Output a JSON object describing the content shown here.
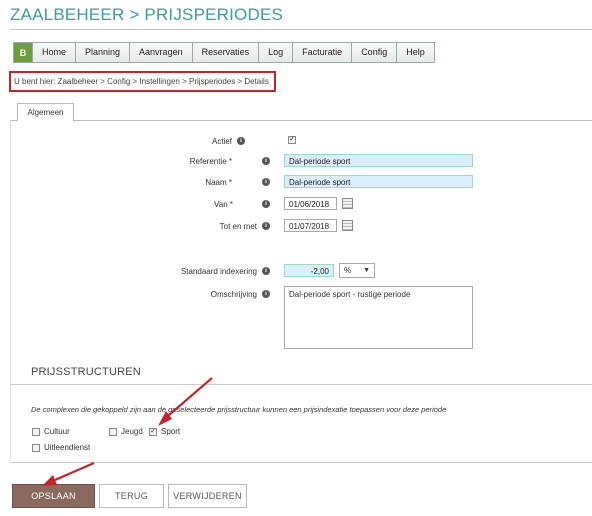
{
  "header": {
    "title": "ZAALBEHEER > PRIJSPERIODES"
  },
  "nav": {
    "logo": "B",
    "items": [
      "Home",
      "Planning",
      "Aanvragen",
      "Reservaties",
      "Log",
      "Facturatie",
      "Config",
      "Help"
    ]
  },
  "breadcrumb": "U bent hier: Zaalbeheer > Config > Instellingen > Prijsperiodes > Details",
  "tabs": [
    "Algemeen"
  ],
  "form": {
    "actief": {
      "label": "Actief",
      "checked": true
    },
    "referentie": {
      "label": "Referentie *",
      "value": "Dal-periode sport"
    },
    "naam": {
      "label": "Naam *",
      "value": "Dal-periode sport"
    },
    "van": {
      "label": "Van *",
      "value": "01/06/2018"
    },
    "tot": {
      "label": "Tot en met",
      "value": "01/07/2018"
    },
    "indexering": {
      "label": "Standaard indexering",
      "value": "-2,00",
      "unit": "%"
    },
    "omschrijving": {
      "label": "Omschrijving",
      "value": "Dal-periode sport - rustige periode"
    }
  },
  "prijsstructuren": {
    "title": "PRIJSSTRUCTUREN",
    "note": "De complexen die gekoppeld zijn aan de geselecteerde prijsstructuur kunnen een prijsindexatie toepassen voor deze periode",
    "options": [
      {
        "label": "Cultuur",
        "checked": false
      },
      {
        "label": "Jeugd",
        "checked": false
      },
      {
        "label": "Sport",
        "checked": true
      },
      {
        "label": "Uitleendienst",
        "checked": false
      }
    ]
  },
  "buttons": {
    "save": "OPSLAAN",
    "back": "TERUG",
    "delete": "VERWIJDEREN"
  },
  "icons": {
    "info": "info-icon",
    "calendar": "calendar-icon",
    "dropdown": "chevron-down-icon",
    "check": "✓"
  },
  "colors": {
    "title": "#3f9a9a",
    "highlight": "#c0262c",
    "primary_button": "#8a6a5e",
    "input_bg": "#dbeefb"
  }
}
